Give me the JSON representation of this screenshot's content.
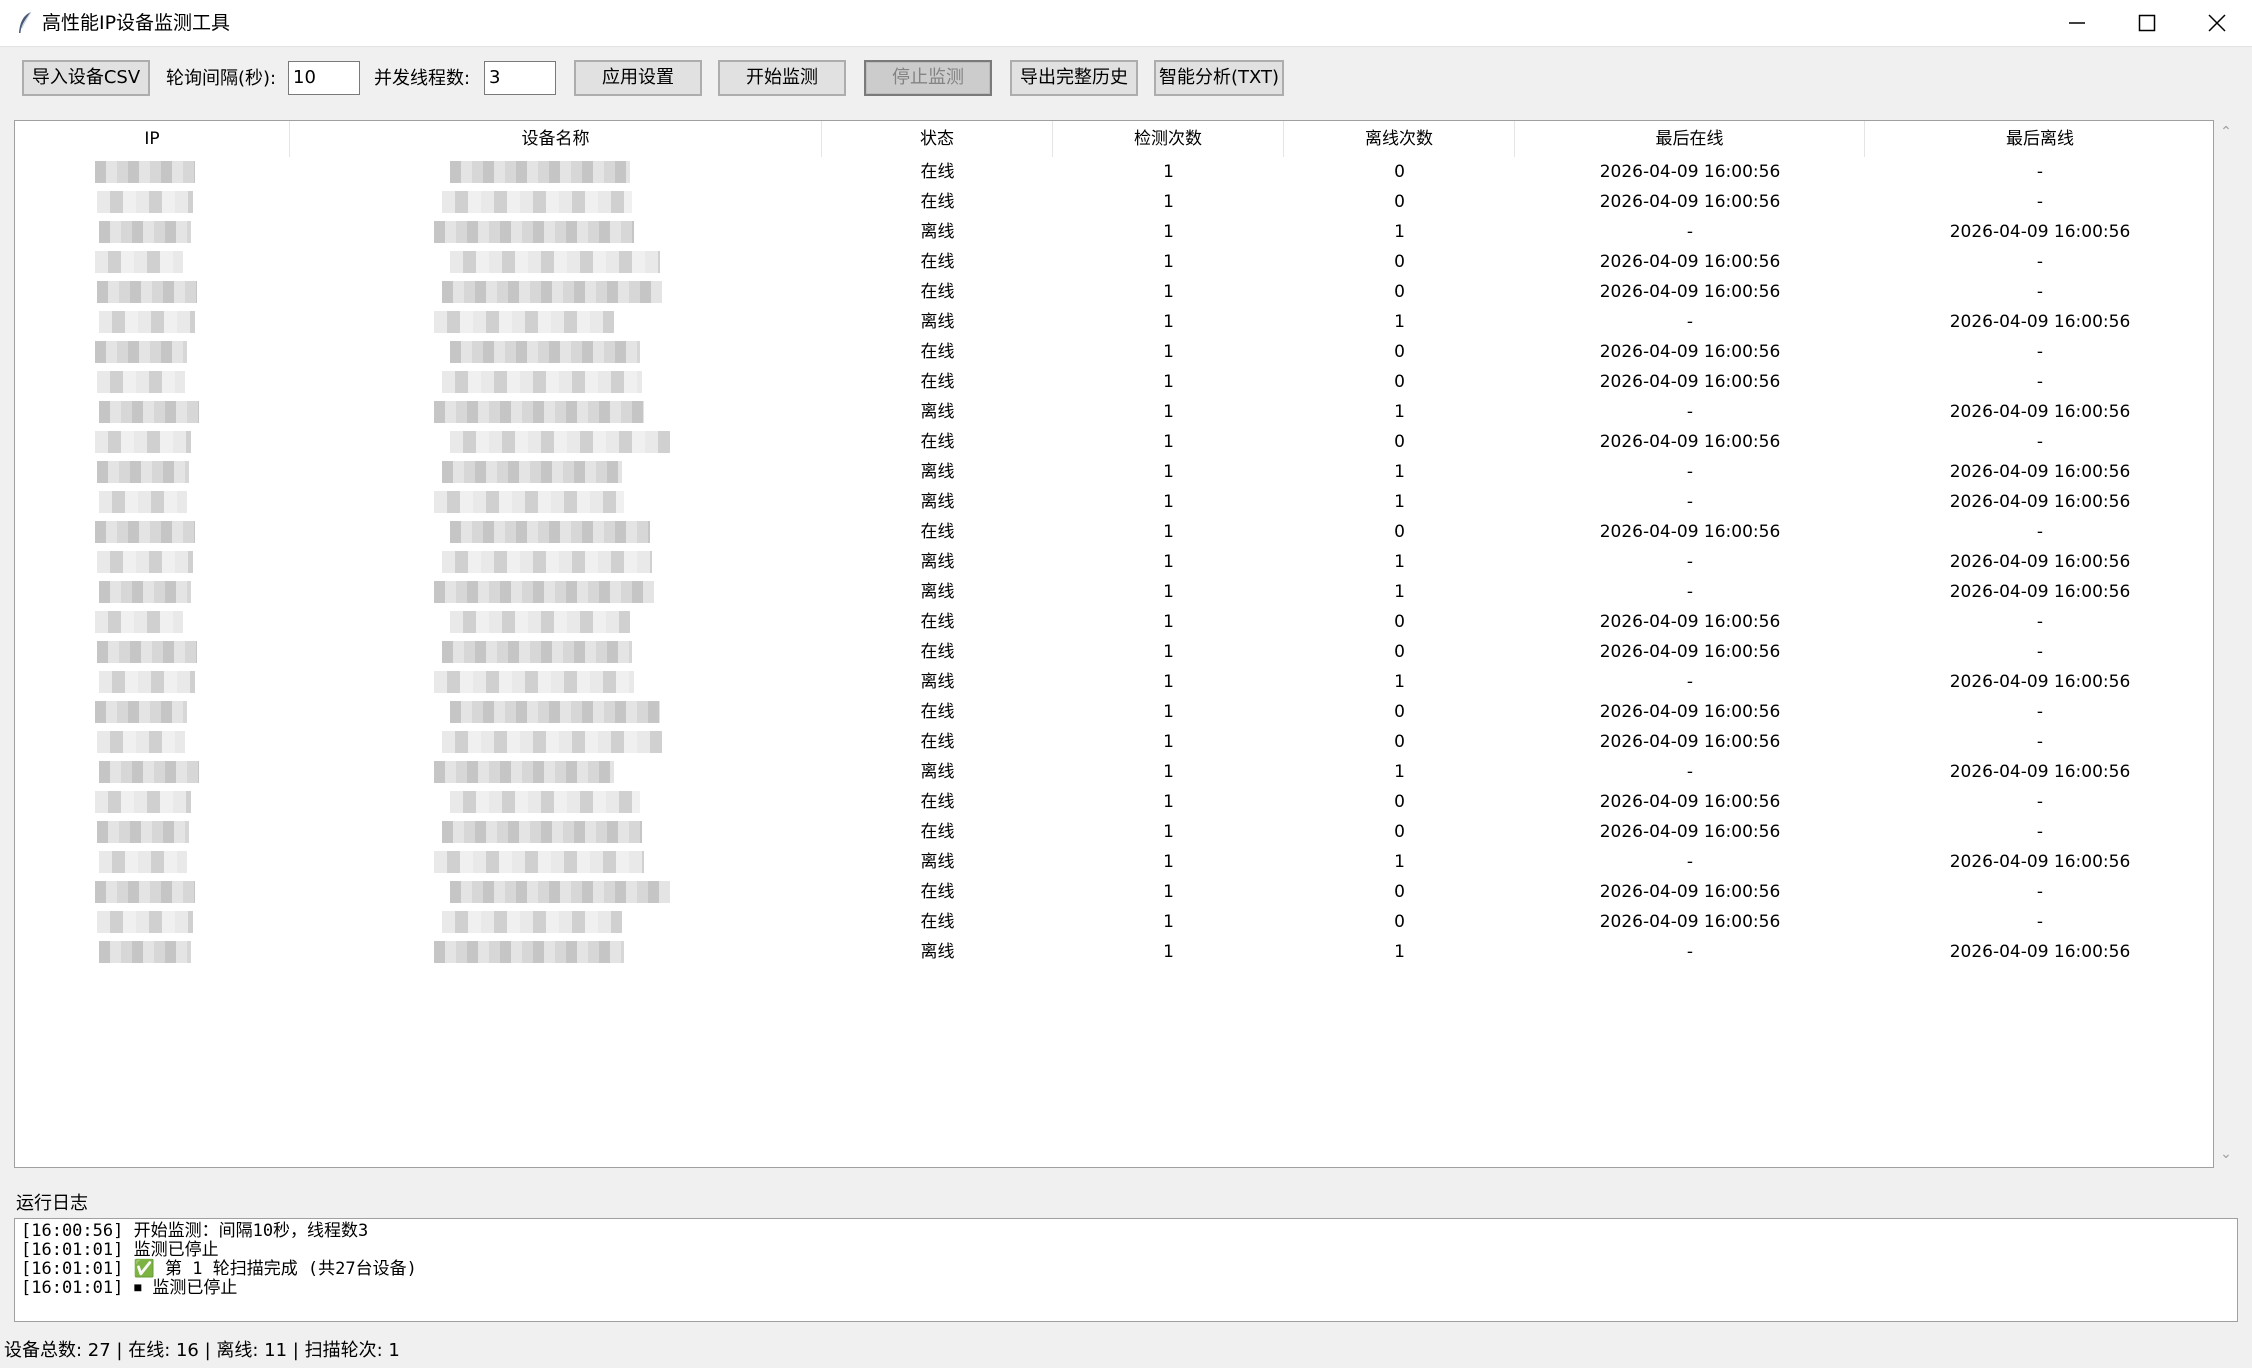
{
  "window": {
    "title": "高性能IP设备监测工具",
    "icon": "feather-icon"
  },
  "toolbar": {
    "import_label": "导入设备CSV",
    "interval_label": "轮询间隔(秒):",
    "interval_value": "10",
    "threads_label": "并发线程数:",
    "threads_value": "3",
    "apply_label": "应用设置",
    "start_label": "开始监测",
    "stop_label": "停止监测",
    "export_label": "导出完整历史",
    "analyze_label": "智能分析(TXT)"
  },
  "table": {
    "columns": [
      "IP",
      "设备名称",
      "状态",
      "检测次数",
      "离线次数",
      "最后在线",
      "最后离线"
    ],
    "rows": [
      [
        "",
        "",
        "在线",
        "1",
        "0",
        "2026-04-09 16:00:56",
        "-"
      ],
      [
        "",
        "",
        "在线",
        "1",
        "0",
        "2026-04-09 16:00:56",
        "-"
      ],
      [
        "",
        "",
        "离线",
        "1",
        "1",
        "-",
        "2026-04-09 16:00:56"
      ],
      [
        "",
        "",
        "在线",
        "1",
        "0",
        "2026-04-09 16:00:56",
        "-"
      ],
      [
        "",
        "",
        "在线",
        "1",
        "0",
        "2026-04-09 16:00:56",
        "-"
      ],
      [
        "",
        "",
        "离线",
        "1",
        "1",
        "-",
        "2026-04-09 16:00:56"
      ],
      [
        "",
        "",
        "在线",
        "1",
        "0",
        "2026-04-09 16:00:56",
        "-"
      ],
      [
        "",
        "",
        "在线",
        "1",
        "0",
        "2026-04-09 16:00:56",
        "-"
      ],
      [
        "",
        "",
        "离线",
        "1",
        "1",
        "-",
        "2026-04-09 16:00:56"
      ],
      [
        "",
        "",
        "在线",
        "1",
        "0",
        "2026-04-09 16:00:56",
        "-"
      ],
      [
        "",
        "",
        "离线",
        "1",
        "1",
        "-",
        "2026-04-09 16:00:56"
      ],
      [
        "",
        "",
        "离线",
        "1",
        "1",
        "-",
        "2026-04-09 16:00:56"
      ],
      [
        "",
        "",
        "在线",
        "1",
        "0",
        "2026-04-09 16:00:56",
        "-"
      ],
      [
        "",
        "",
        "离线",
        "1",
        "1",
        "-",
        "2026-04-09 16:00:56"
      ],
      [
        "",
        "",
        "离线",
        "1",
        "1",
        "-",
        "2026-04-09 16:00:56"
      ],
      [
        "",
        "",
        "在线",
        "1",
        "0",
        "2026-04-09 16:00:56",
        "-"
      ],
      [
        "",
        "",
        "在线",
        "1",
        "0",
        "2026-04-09 16:00:56",
        "-"
      ],
      [
        "",
        "",
        "离线",
        "1",
        "1",
        "-",
        "2026-04-09 16:00:56"
      ],
      [
        "",
        "",
        "在线",
        "1",
        "0",
        "2026-04-09 16:00:56",
        "-"
      ],
      [
        "",
        "",
        "在线",
        "1",
        "0",
        "2026-04-09 16:00:56",
        "-"
      ],
      [
        "",
        "",
        "离线",
        "1",
        "1",
        "-",
        "2026-04-09 16:00:56"
      ],
      [
        "",
        "",
        "在线",
        "1",
        "0",
        "2026-04-09 16:00:56",
        "-"
      ],
      [
        "",
        "",
        "在线",
        "1",
        "0",
        "2026-04-09 16:00:56",
        "-"
      ],
      [
        "",
        "",
        "离线",
        "1",
        "1",
        "-",
        "2026-04-09 16:00:56"
      ],
      [
        "",
        "",
        "在线",
        "1",
        "0",
        "2026-04-09 16:00:56",
        "-"
      ],
      [
        "",
        "",
        "在线",
        "1",
        "0",
        "2026-04-09 16:00:56",
        "-"
      ],
      [
        "",
        "",
        "离线",
        "1",
        "1",
        "-",
        "2026-04-09 16:00:56"
      ]
    ]
  },
  "log": {
    "label": "运行日志",
    "lines": [
      "[16:00:56] 开始监测：间隔10秒，线程数3",
      "[16:01:01] 监测已停止",
      "[16:01:01] ✅ 第 1 轮扫描完成 (共27台设备)",
      "[16:01:01] ⏹ 监测已停止"
    ]
  },
  "status": {
    "text": "设备总数: 27 | 在线: 16 | 离线: 11 | 扫描轮次: 1"
  }
}
